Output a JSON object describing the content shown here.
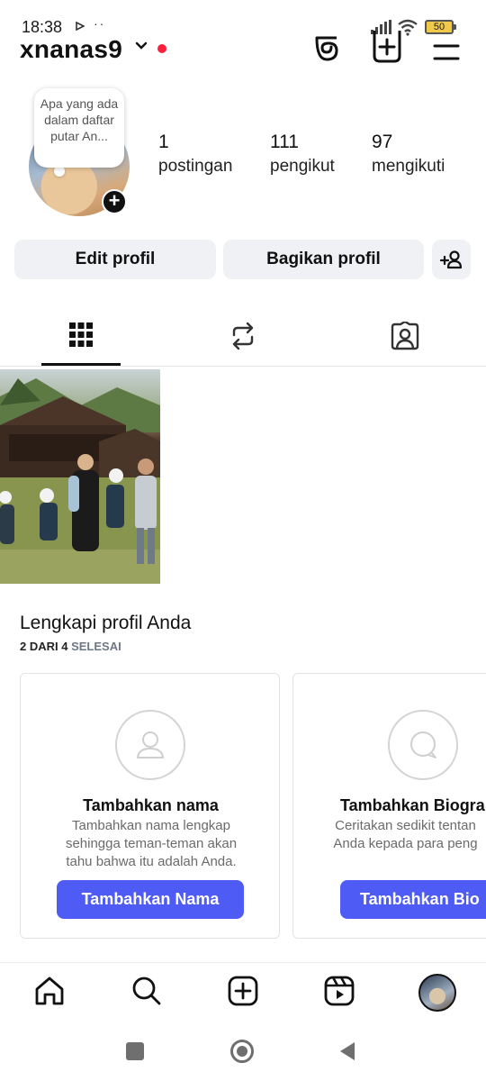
{
  "status_bar": {
    "time": "18:38",
    "dots": "··",
    "battery": "50"
  },
  "header": {
    "username": "xnanas9"
  },
  "note": {
    "text": "Apa yang ada dalam daftar putar An..."
  },
  "stats": [
    {
      "value": "1",
      "label": "postingan"
    },
    {
      "value": "111",
      "label": "pengikut"
    },
    {
      "value": "97",
      "label": "mengikuti"
    }
  ],
  "actions": {
    "edit": "Edit profil",
    "share": "Bagikan profil"
  },
  "complete_profile": {
    "title": "Lengkapi profil Anda",
    "progress": "2 DARI 4",
    "progress_suffix": "SELESAI",
    "cards": [
      {
        "title": "Tambahkan nama",
        "desc": "Tambahkan nama lengkap sehingga teman-teman akan tahu bahwa itu adalah Anda.",
        "button": "Tambahkan Nama"
      },
      {
        "title": "Tambahkan Biogra",
        "desc": "Ceritakan sedikit tentan Anda kepada para peng",
        "button": "Tambahkan Bio"
      }
    ]
  },
  "colors": {
    "accent": "#4f5bf5",
    "live_dot": "#ff1f3d",
    "button_bg": "#eff1f4"
  },
  "icons": [
    "threads-icon",
    "add-post-icon",
    "menu-icon",
    "grid-icon",
    "reposts-icon",
    "tagged-icon",
    "home-icon",
    "search-icon",
    "create-icon",
    "reels-icon"
  ]
}
